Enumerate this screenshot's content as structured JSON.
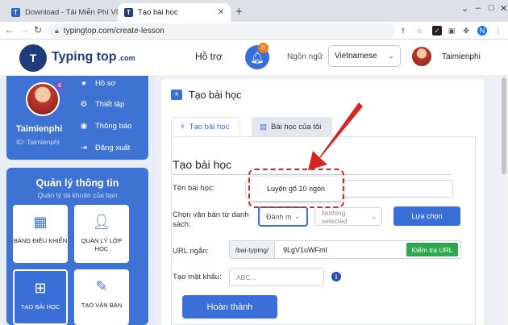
{
  "browser": {
    "tabs": [
      {
        "favicon": "T",
        "title": "Download - Tải Miễn Phí VN - Ph"
      },
      {
        "favicon": "T",
        "title": "Tạo bài học"
      }
    ],
    "new_tab": "+",
    "url": "typingtop.com/create-lesson",
    "profile_initial": "N"
  },
  "header": {
    "brand": "Typing top",
    "brand_suffix": ".com",
    "support": "Hỗ trợ",
    "notification_count": "0",
    "language_label": "Ngôn ngữ",
    "language_value": "Vietnamese",
    "username": "Taimienphi"
  },
  "sidebar": {
    "profile": {
      "name": "Taimienphi",
      "id": "ID: Taimienphi",
      "menu": [
        {
          "label": "Hồ sơ",
          "icon": "user-icon"
        },
        {
          "label": "Thiết lập",
          "icon": "gear-icon"
        },
        {
          "label": "Thông báo",
          "icon": "bell-icon"
        },
        {
          "label": "Đăng xuất",
          "icon": "logout-icon"
        }
      ]
    },
    "info": {
      "title": "Quản lý thông tin",
      "subtitle": "Quản lý tài khoản của bạn",
      "tiles": [
        {
          "label": "BẢNG ĐIỀU KHIỂN",
          "icon": "dashboard-icon"
        },
        {
          "label": "QUẢN LÝ LỚP HỌC",
          "icon": "class-manage-icon"
        },
        {
          "label": "TẠO BÀI HỌC",
          "icon": "add-lesson-icon"
        },
        {
          "label": "TẠO VĂN BẢN",
          "icon": "pen-icon"
        }
      ]
    }
  },
  "main": {
    "page_title": "Tạo bài học",
    "tabs": [
      {
        "label": "Tạo bài học",
        "icon": "bolt-icon"
      },
      {
        "label": "Bài học của tôi",
        "icon": "book-icon"
      }
    ],
    "form": {
      "title": "Tạo bài học",
      "lesson_name_label": "Tên bài học:",
      "lesson_name_value": "Luyện gõ 10 ngón",
      "text_select_label": "Chọn văn bản từ danh sách:",
      "sort_value": "Đánh m",
      "nothing_selected": "Nothing selected",
      "choose_button": "Lựa chọn",
      "url_label": "URL ngắn:",
      "url_prefix": "/bai-typing/",
      "url_value": "9LgV1uWFmI",
      "check_url_button": "Kiểm tra URL",
      "password_label": "Tạo mật khẩu:",
      "password_placeholder": "ABC...",
      "done_button": "Hoàn thành"
    }
  },
  "colors": {
    "primary": "#3a6fd8",
    "highlight": "#d72424",
    "success": "#2aa84a",
    "badge": "#f07b1a"
  }
}
